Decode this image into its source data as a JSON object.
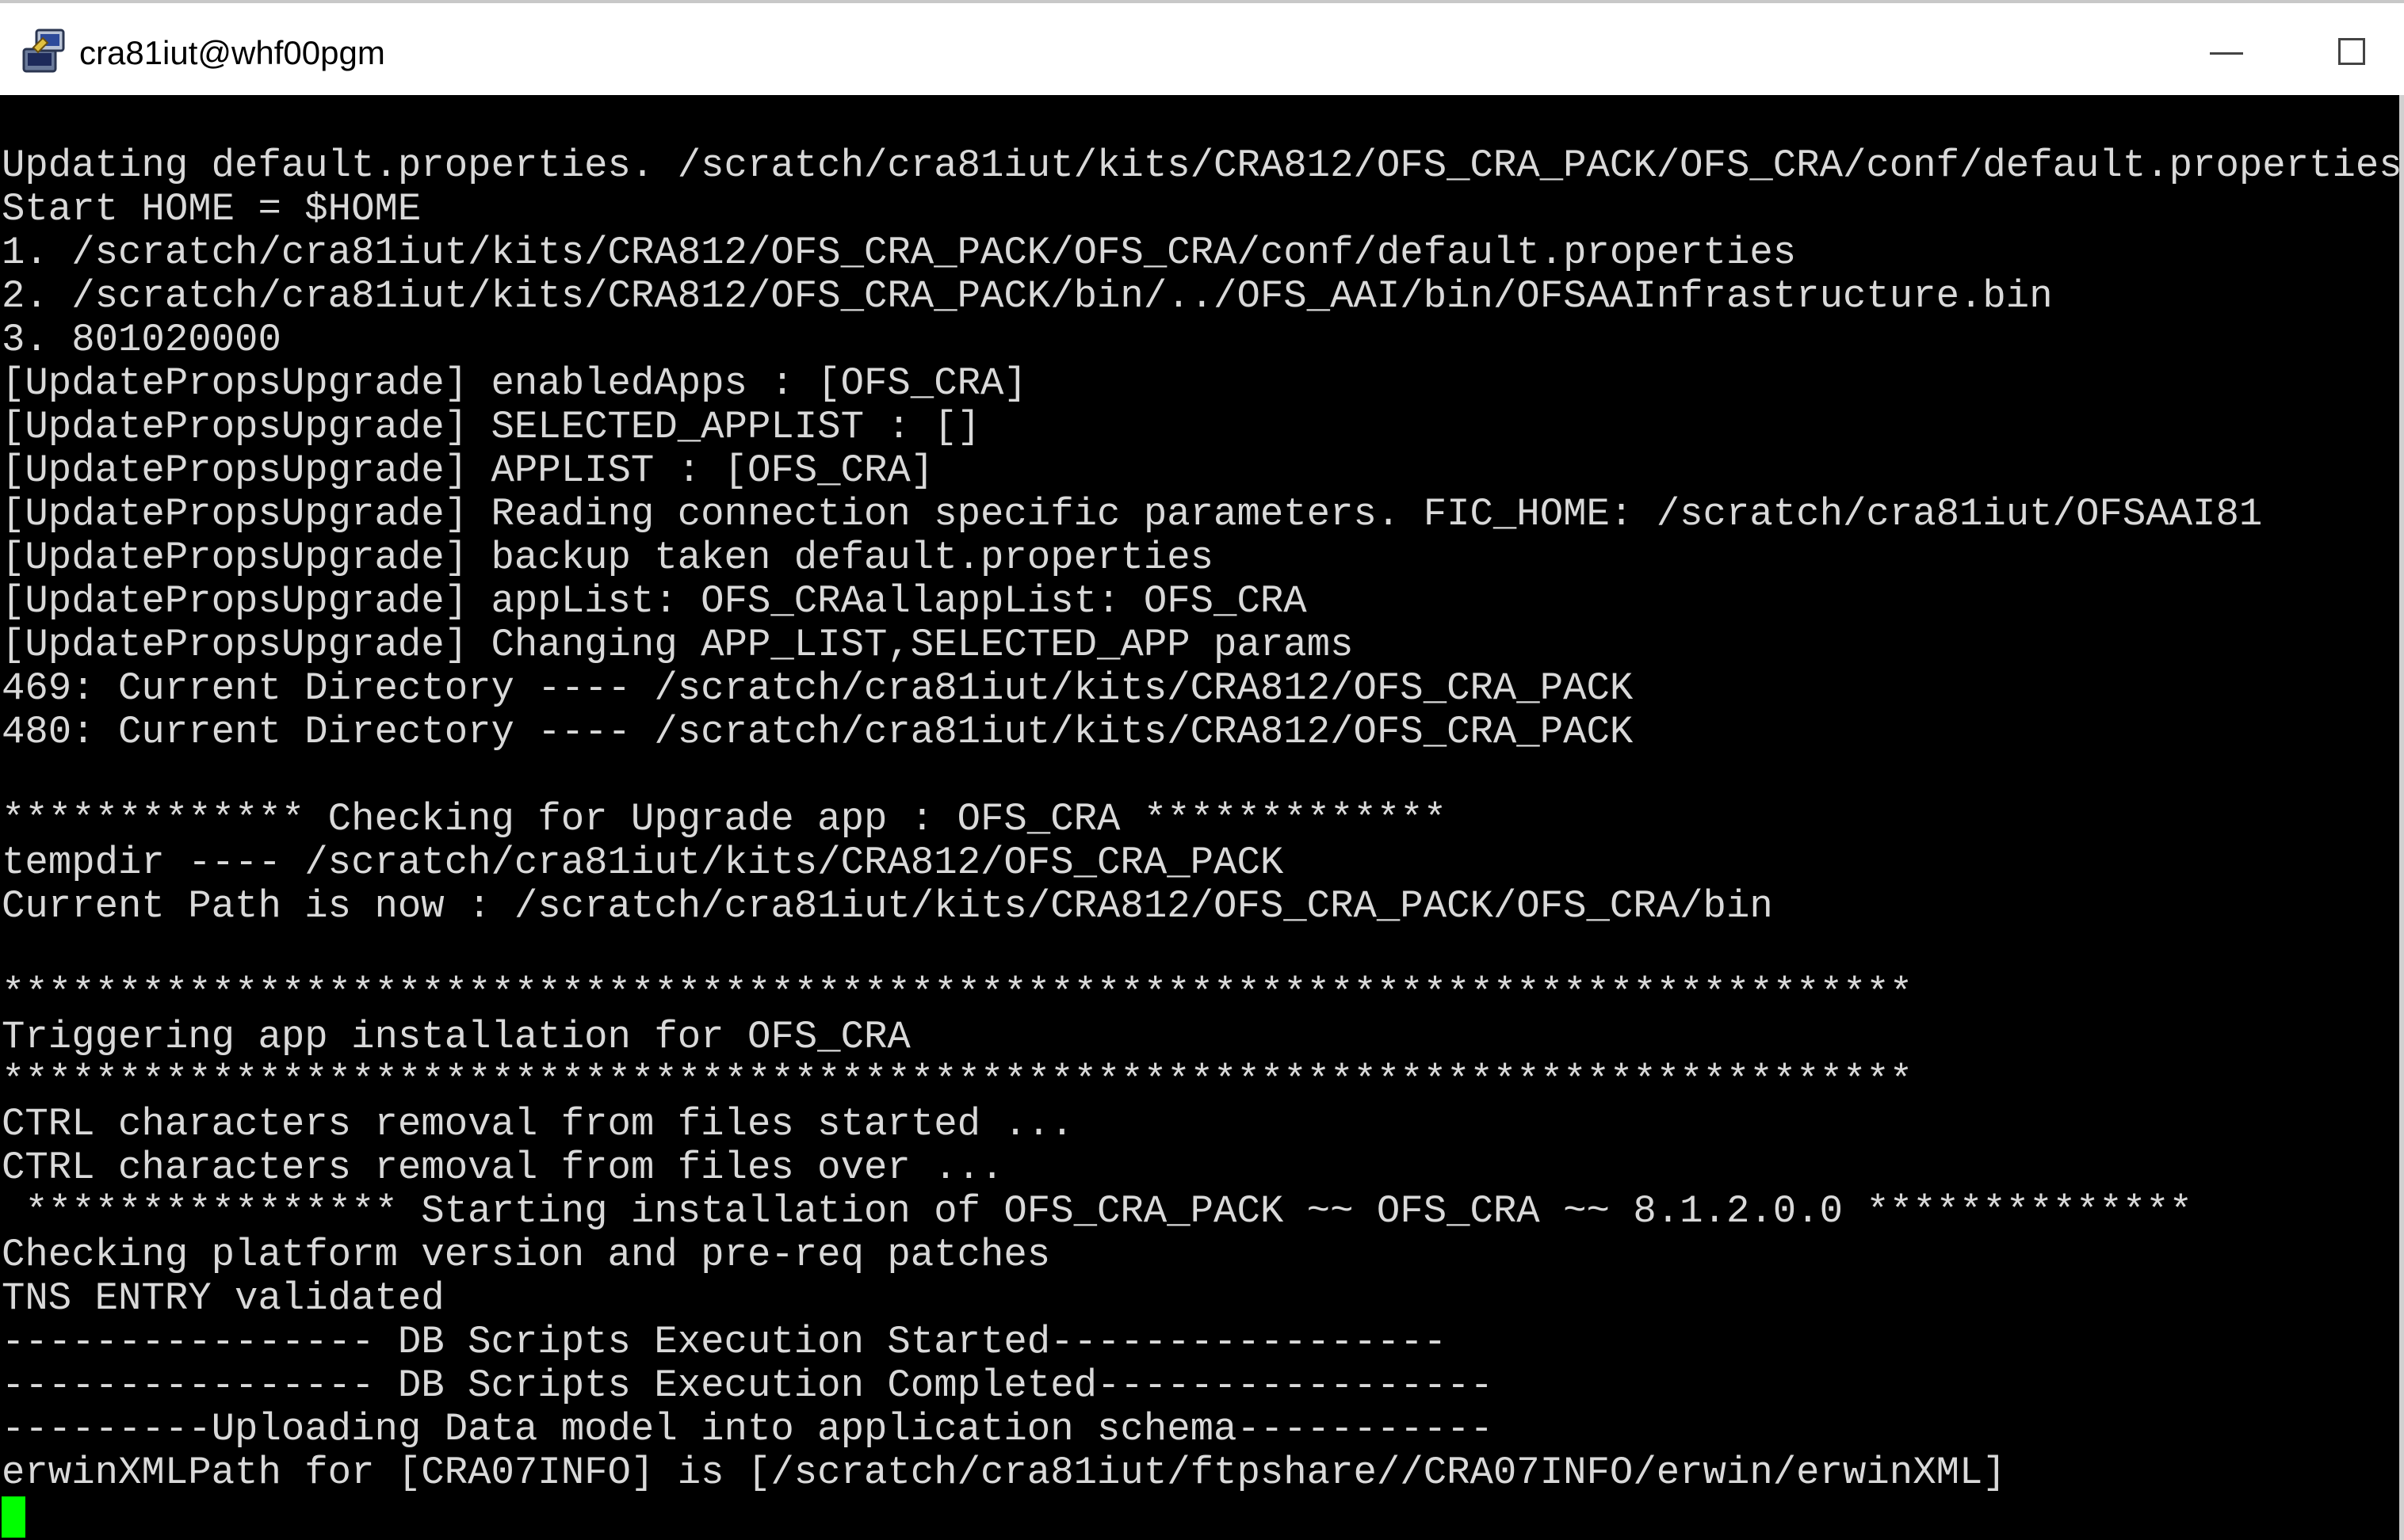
{
  "window": {
    "title": "cra81iut@whf00pgm",
    "app_icon": "putty-terminal-icon",
    "controls": {
      "minimize_icon": "minimize-icon",
      "maximize_icon": "maximize-icon"
    }
  },
  "terminal": {
    "background": "#000000",
    "foreground": "#d9d9d9",
    "cursor_color": "#00ff00",
    "lines": [
      "Updating default.properties. /scratch/cra81iut/kits/CRA812/OFS_CRA_PACK/OFS_CRA/conf/default.properties",
      "Start HOME = $HOME",
      "1. /scratch/cra81iut/kits/CRA812/OFS_CRA_PACK/OFS_CRA/conf/default.properties",
      "2. /scratch/cra81iut/kits/CRA812/OFS_CRA_PACK/bin/../OFS_AAI/bin/OFSAAInfrastructure.bin",
      "3. 801020000",
      "[UpdatePropsUpgrade] enabledApps : [OFS_CRA]",
      "[UpdatePropsUpgrade] SELECTED_APPLIST : []",
      "[UpdatePropsUpgrade] APPLIST : [OFS_CRA]",
      "[UpdatePropsUpgrade] Reading connection specific parameters. FIC_HOME: /scratch/cra81iut/OFSAAI81",
      "[UpdatePropsUpgrade] backup taken default.properties",
      "[UpdatePropsUpgrade] appList: OFS_CRAallappList: OFS_CRA",
      "[UpdatePropsUpgrade] Changing APP_LIST,SELECTED_APP params",
      "469: Current Directory ---- /scratch/cra81iut/kits/CRA812/OFS_CRA_PACK",
      "480: Current Directory ---- /scratch/cra81iut/kits/CRA812/OFS_CRA_PACK",
      "",
      "************* Checking for Upgrade app : OFS_CRA *************",
      "tempdir ---- /scratch/cra81iut/kits/CRA812/OFS_CRA_PACK",
      "Current Path is now : /scratch/cra81iut/kits/CRA812/OFS_CRA_PACK/OFS_CRA/bin",
      "",
      "**********************************************************************************",
      "Triggering app installation for OFS_CRA",
      "**********************************************************************************",
      "CTRL characters removal from files started ...",
      "CTRL characters removal from files over ...",
      " **************** Starting installation of OFS_CRA_PACK ~~ OFS_CRA ~~ 8.1.2.0.0 **************",
      "Checking platform version and pre-req patches",
      "TNS ENTRY validated",
      "---------------- DB Scripts Execution Started-----------------",
      "---------------- DB Scripts Execution Completed-----------------",
      "---------Uploading Data model into application schema-----------",
      "erwinXMLPath for [CRA07INFO] is [/scratch/cra81iut/ftpshare//CRA07INFO/erwin/erwinXML]"
    ]
  }
}
